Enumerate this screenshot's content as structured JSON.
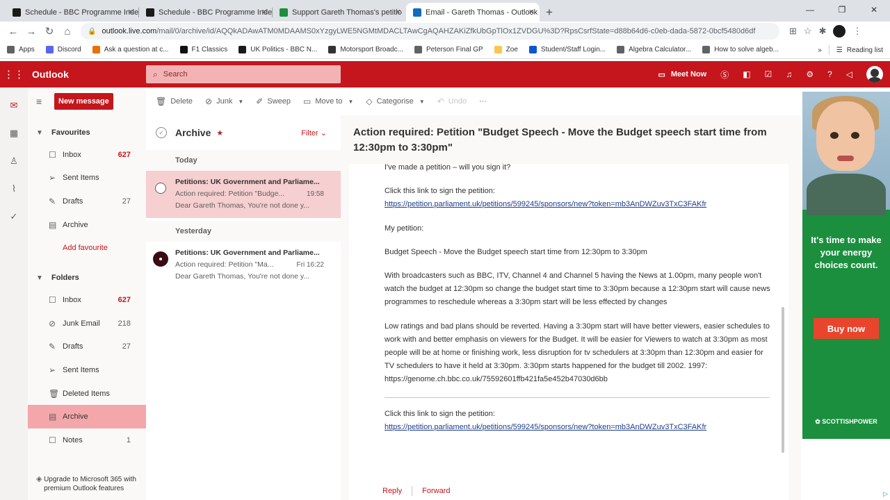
{
  "browser": {
    "tabs": [
      {
        "title": "Schedule - BBC Programme Inde",
        "color": "#1a1a1a",
        "active": false
      },
      {
        "title": "Schedule - BBC Programme Inde",
        "color": "#1a1a1a",
        "active": false
      },
      {
        "title": "Support Gareth Thomas's petitio",
        "color": "#1e8e3e",
        "active": false
      },
      {
        "title": "Email - Gareth Thomas - Outlook",
        "color": "#0f6cbd",
        "active": true
      }
    ],
    "url_host": "outlook.live.com",
    "url_path": "/mail/0/archive/id/AQQkADAwATM0MDAAMS0xYzgyLWE5NGMtMDACLTAwCgAQAHZAKiZfkUbGpTlOx1ZVDGU%3D?RpsCsrfState=d88b64d6-c0eb-dada-5872-0bcf5480d6df",
    "bookmarks": [
      {
        "label": "Apps",
        "color": "#5f6368"
      },
      {
        "label": "Discord",
        "color": "#5865f2"
      },
      {
        "label": "Ask a question at c...",
        "color": "#e8710a"
      },
      {
        "label": "F1 Classics",
        "color": "#111111"
      },
      {
        "label": "UK Politics - BBC N...",
        "color": "#1a1a1a"
      },
      {
        "label": "Motorsport Broadc...",
        "color": "#333333"
      },
      {
        "label": "Peterson Final GP",
        "color": "#5f6368"
      },
      {
        "label": "Zoe",
        "color": "#f9c74f"
      },
      {
        "label": "Student/Staff Login...",
        "color": "#0b57d0"
      },
      {
        "label": "Algebra Calculator...",
        "color": "#5f6368"
      },
      {
        "label": "How to solve algeb...",
        "color": "#5f6368"
      }
    ],
    "reading_list": "Reading list"
  },
  "outlook": {
    "brand": "Outlook",
    "search_placeholder": "Search",
    "meet_now": "Meet Now",
    "new_message": "New message",
    "favourites_label": "Favourites",
    "folders_label": "Folders",
    "add_favourite": "Add favourite",
    "upgrade_text": "Upgrade to Microsoft 365 with premium Outlook features",
    "favourites": [
      {
        "label": "Inbox",
        "count": "627",
        "red": true,
        "icon": "inbox-icon",
        "glyph": "☐"
      },
      {
        "label": "Sent Items",
        "count": "",
        "red": false,
        "icon": "send-icon",
        "glyph": "➢"
      },
      {
        "label": "Drafts",
        "count": "27",
        "red": false,
        "icon": "pencil-icon",
        "glyph": "✎"
      },
      {
        "label": "Archive",
        "count": "",
        "red": false,
        "icon": "archive-icon",
        "glyph": "▤"
      }
    ],
    "folders": [
      {
        "label": "Inbox",
        "count": "627",
        "red": true,
        "icon": "inbox-icon",
        "glyph": "☐",
        "active": false
      },
      {
        "label": "Junk Email",
        "count": "218",
        "red": false,
        "icon": "block-icon",
        "glyph": "⊘",
        "active": false
      },
      {
        "label": "Drafts",
        "count": "27",
        "red": false,
        "icon": "pencil-icon",
        "glyph": "✎",
        "active": false
      },
      {
        "label": "Sent Items",
        "count": "",
        "red": false,
        "icon": "send-icon",
        "glyph": "➢",
        "active": false
      },
      {
        "label": "Deleted Items",
        "count": "",
        "red": false,
        "icon": "trash-icon",
        "glyph": "🗑",
        "active": false
      },
      {
        "label": "Archive",
        "count": "",
        "red": false,
        "icon": "archive-icon",
        "glyph": "▤",
        "active": true
      },
      {
        "label": "Notes",
        "count": "1",
        "red": false,
        "icon": "note-icon",
        "glyph": "☐",
        "active": false
      }
    ],
    "commands": {
      "delete": "Delete",
      "junk": "Junk",
      "sweep": "Sweep",
      "move_to": "Move to",
      "categorise": "Categorise",
      "undo": "Undo"
    },
    "list": {
      "title": "Archive",
      "filter": "Filter",
      "groups": [
        {
          "label": "Today",
          "items": [
            {
              "sender": "Petitions: UK Government and Parliame...",
              "subject": "Action required: Petition \"Budge...",
              "time": "19:58",
              "preview": "Dear Gareth Thomas, You're not done y...",
              "selected": true
            }
          ]
        },
        {
          "label": "Yesterday",
          "items": [
            {
              "sender": "Petitions: UK Government and Parliame...",
              "subject": "Action required: Petition \"Ma...",
              "time": "Fri 16:22",
              "preview": "Dear Gareth Thomas, You're not done y...",
              "selected": false
            }
          ]
        }
      ]
    },
    "reading": {
      "subject": "Action required: Petition \"Budget Speech - Move the Budget speech start time from 12:30pm to 3:30pm\"",
      "p_intro": "I've made a petition – will you sign it?",
      "p_click": "Click this link to sign the petition:",
      "link": "https://petition.parliament.uk/petitions/599245/sponsors/new?token=mb3AnDWZuv3TxC3FAKfr",
      "p_my": "My petition:",
      "p_title": "Budget Speech - Move the Budget speech start time from 12:30pm to 3:30pm",
      "p_body1": "With broadcasters such as BBC, ITV, Channel 4 and Channel 5 having the News at 1.00pm, many people won't watch the budget at 12:30pm so change the budget start time to 3:30pm because a 12:30pm start will cause news programmes to reschedule whereas a 3:30pm start will be less effected by changes",
      "p_body2": "Low ratings and bad plans should be reverted. Having a 3:30pm start will have better viewers, easier schedules to work with and better emphasis on viewers for the Budget. It will be easier for Viewers to watch at 3:30pm as most people will be at home or finishing work, less disruption for tv schedulers at 3:30pm than 12:30pm and easier for TV schedulers to have it held at 3:30pm. 3:30pm starts happened for the budget till 2002. 1997: https://genome.ch.bbc.co.uk/75592601ffb421fa5e452b47030d6bb",
      "p_click2": "Click this link to sign the petition:",
      "link2": "https://petition.parliament.uk/petitions/599245/sponsors/new?token=mb3AnDWZuv3TxC3FAKfr",
      "reply": "Reply",
      "forward": "Forward"
    }
  },
  "ad": {
    "headline": "It's time to make your energy choices count.",
    "button": "Buy now",
    "brand": "SCOTTISHPOWER"
  }
}
